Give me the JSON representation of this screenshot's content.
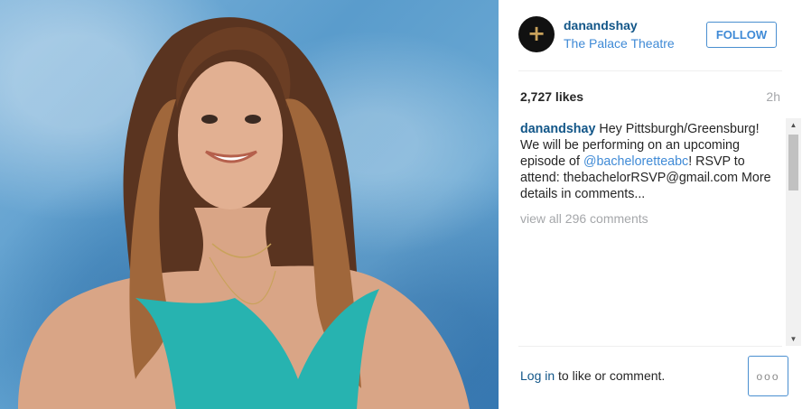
{
  "post": {
    "username": "danandshay",
    "location": "The Palace Theatre",
    "follow_label": "FOLLOW",
    "likes": "2,727 likes",
    "time": "2h",
    "avatar_icon": "plus-icon",
    "caption": {
      "user": "danandshay",
      "text_before": " Hey Pittsburgh/Greensburg! We will be performing on an upcoming episode of ",
      "mention": "@bacheloretteabc",
      "text_after": "! RSVP to attend: thebachelorRSVP@gmail.com More details in comments..."
    },
    "view_all": "view all 296 comments",
    "login_link": "Log in",
    "login_rest": " to like or comment.",
    "more_label": "ooo"
  },
  "colors": {
    "username": "#125688",
    "link": "#3f8ad6",
    "muted": "#a5a7aa",
    "dress": "#27b3b0"
  }
}
